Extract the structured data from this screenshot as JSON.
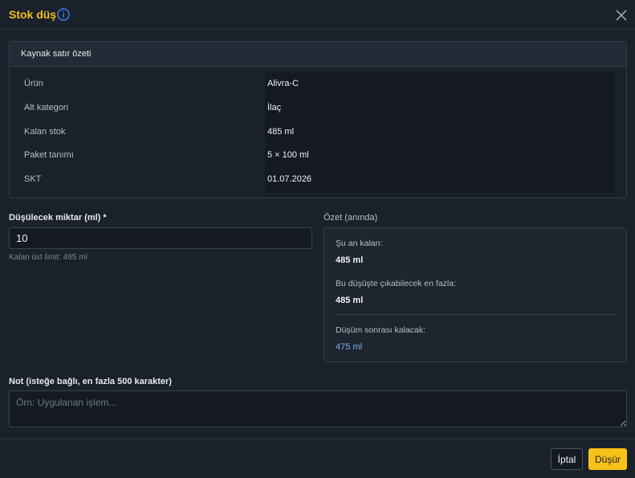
{
  "dialog": {
    "title": "Stok düş",
    "info_icon": "info-icon",
    "close_icon": "close-icon"
  },
  "summary": {
    "title": "Kaynak satır özeti",
    "rows": [
      {
        "label": "Ürün",
        "value": "Alivra-C"
      },
      {
        "label": "Alt kategori",
        "value": "İlaç"
      },
      {
        "label": "Kalan stok",
        "value": "485 ml"
      },
      {
        "label": "Paket tanımı",
        "value": "5 × 100 ml"
      },
      {
        "label": "SKT",
        "value": "01.07.2026"
      }
    ]
  },
  "quantity": {
    "label": "Düşülecek miktar (ml) *",
    "value": "10",
    "hint": "Kalan üst limit: 485 ml"
  },
  "preview": {
    "label": "Özet (anında)",
    "current_label": "Şu an kalan:",
    "current_value": "485 ml",
    "max_label": "Bu düşüşte çıkabilecek en fazla:",
    "max_value": "485 ml",
    "after_label": "Düşüm sonrası kalacak:",
    "after_value": "475 ml"
  },
  "note": {
    "label": "Not (isteğe bağlı, en fazla 500 karakter)",
    "placeholder": "Örn: Uygulanan işlem...",
    "value": ""
  },
  "footer": {
    "cancel_label": "İptal",
    "submit_label": "Düşür"
  },
  "colors": {
    "accent_title": "#f2c01d",
    "primary_button": "#f5c218",
    "after_value": "#7db0f0",
    "background": "#1b212a"
  }
}
